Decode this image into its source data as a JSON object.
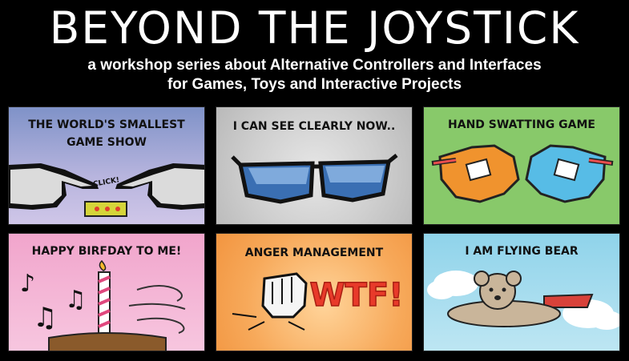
{
  "title": "BEYOND THE JOYSTICK",
  "subtitle_line1": "a workshop series about Alternative Controllers and Interfaces",
  "subtitle_line2": "for Games, Toys and Interactive Projects",
  "panels": [
    {
      "title_line1": "THE WORLD'S SMALLEST",
      "title_line2": "GAME SHOW",
      "annotation": "CLICK!"
    },
    {
      "title_line1": "I CAN SEE CLEARLY NOW.."
    },
    {
      "title_line1": "HAND SWATTING GAME"
    },
    {
      "title_line1": "HAPPY BIRFDAY TO ME!"
    },
    {
      "title_line1": "ANGER MANAGEMENT",
      "annotation": "WTF!"
    },
    {
      "title_line1": "I AM FLYING BEAR"
    }
  ]
}
